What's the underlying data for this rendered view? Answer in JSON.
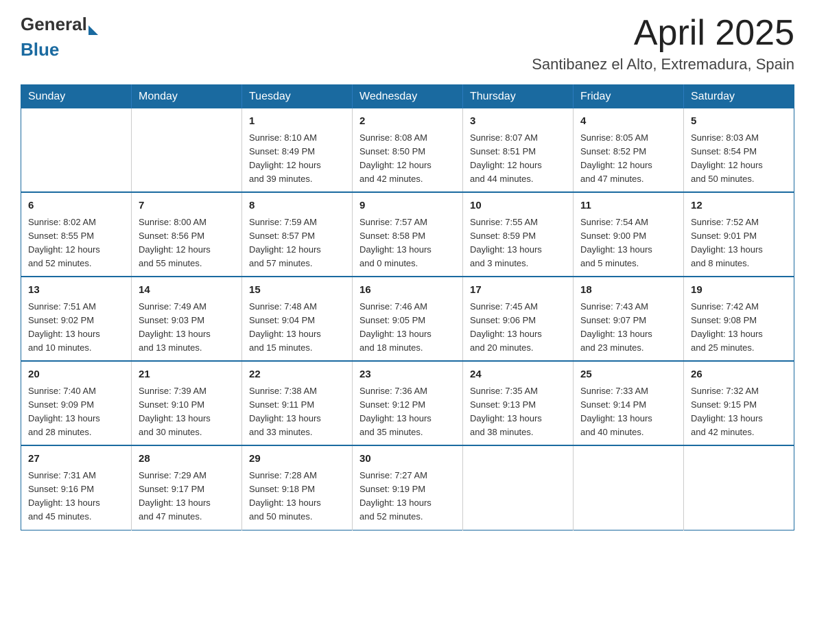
{
  "header": {
    "logo_general": "General",
    "logo_blue": "Blue",
    "title": "April 2025",
    "subtitle": "Santibanez el Alto, Extremadura, Spain"
  },
  "calendar": {
    "days_of_week": [
      "Sunday",
      "Monday",
      "Tuesday",
      "Wednesday",
      "Thursday",
      "Friday",
      "Saturday"
    ],
    "weeks": [
      [
        {
          "day": "",
          "info": ""
        },
        {
          "day": "",
          "info": ""
        },
        {
          "day": "1",
          "info": "Sunrise: 8:10 AM\nSunset: 8:49 PM\nDaylight: 12 hours\nand 39 minutes."
        },
        {
          "day": "2",
          "info": "Sunrise: 8:08 AM\nSunset: 8:50 PM\nDaylight: 12 hours\nand 42 minutes."
        },
        {
          "day": "3",
          "info": "Sunrise: 8:07 AM\nSunset: 8:51 PM\nDaylight: 12 hours\nand 44 minutes."
        },
        {
          "day": "4",
          "info": "Sunrise: 8:05 AM\nSunset: 8:52 PM\nDaylight: 12 hours\nand 47 minutes."
        },
        {
          "day": "5",
          "info": "Sunrise: 8:03 AM\nSunset: 8:54 PM\nDaylight: 12 hours\nand 50 minutes."
        }
      ],
      [
        {
          "day": "6",
          "info": "Sunrise: 8:02 AM\nSunset: 8:55 PM\nDaylight: 12 hours\nand 52 minutes."
        },
        {
          "day": "7",
          "info": "Sunrise: 8:00 AM\nSunset: 8:56 PM\nDaylight: 12 hours\nand 55 minutes."
        },
        {
          "day": "8",
          "info": "Sunrise: 7:59 AM\nSunset: 8:57 PM\nDaylight: 12 hours\nand 57 minutes."
        },
        {
          "day": "9",
          "info": "Sunrise: 7:57 AM\nSunset: 8:58 PM\nDaylight: 13 hours\nand 0 minutes."
        },
        {
          "day": "10",
          "info": "Sunrise: 7:55 AM\nSunset: 8:59 PM\nDaylight: 13 hours\nand 3 minutes."
        },
        {
          "day": "11",
          "info": "Sunrise: 7:54 AM\nSunset: 9:00 PM\nDaylight: 13 hours\nand 5 minutes."
        },
        {
          "day": "12",
          "info": "Sunrise: 7:52 AM\nSunset: 9:01 PM\nDaylight: 13 hours\nand 8 minutes."
        }
      ],
      [
        {
          "day": "13",
          "info": "Sunrise: 7:51 AM\nSunset: 9:02 PM\nDaylight: 13 hours\nand 10 minutes."
        },
        {
          "day": "14",
          "info": "Sunrise: 7:49 AM\nSunset: 9:03 PM\nDaylight: 13 hours\nand 13 minutes."
        },
        {
          "day": "15",
          "info": "Sunrise: 7:48 AM\nSunset: 9:04 PM\nDaylight: 13 hours\nand 15 minutes."
        },
        {
          "day": "16",
          "info": "Sunrise: 7:46 AM\nSunset: 9:05 PM\nDaylight: 13 hours\nand 18 minutes."
        },
        {
          "day": "17",
          "info": "Sunrise: 7:45 AM\nSunset: 9:06 PM\nDaylight: 13 hours\nand 20 minutes."
        },
        {
          "day": "18",
          "info": "Sunrise: 7:43 AM\nSunset: 9:07 PM\nDaylight: 13 hours\nand 23 minutes."
        },
        {
          "day": "19",
          "info": "Sunrise: 7:42 AM\nSunset: 9:08 PM\nDaylight: 13 hours\nand 25 minutes."
        }
      ],
      [
        {
          "day": "20",
          "info": "Sunrise: 7:40 AM\nSunset: 9:09 PM\nDaylight: 13 hours\nand 28 minutes."
        },
        {
          "day": "21",
          "info": "Sunrise: 7:39 AM\nSunset: 9:10 PM\nDaylight: 13 hours\nand 30 minutes."
        },
        {
          "day": "22",
          "info": "Sunrise: 7:38 AM\nSunset: 9:11 PM\nDaylight: 13 hours\nand 33 minutes."
        },
        {
          "day": "23",
          "info": "Sunrise: 7:36 AM\nSunset: 9:12 PM\nDaylight: 13 hours\nand 35 minutes."
        },
        {
          "day": "24",
          "info": "Sunrise: 7:35 AM\nSunset: 9:13 PM\nDaylight: 13 hours\nand 38 minutes."
        },
        {
          "day": "25",
          "info": "Sunrise: 7:33 AM\nSunset: 9:14 PM\nDaylight: 13 hours\nand 40 minutes."
        },
        {
          "day": "26",
          "info": "Sunrise: 7:32 AM\nSunset: 9:15 PM\nDaylight: 13 hours\nand 42 minutes."
        }
      ],
      [
        {
          "day": "27",
          "info": "Sunrise: 7:31 AM\nSunset: 9:16 PM\nDaylight: 13 hours\nand 45 minutes."
        },
        {
          "day": "28",
          "info": "Sunrise: 7:29 AM\nSunset: 9:17 PM\nDaylight: 13 hours\nand 47 minutes."
        },
        {
          "day": "29",
          "info": "Sunrise: 7:28 AM\nSunset: 9:18 PM\nDaylight: 13 hours\nand 50 minutes."
        },
        {
          "day": "30",
          "info": "Sunrise: 7:27 AM\nSunset: 9:19 PM\nDaylight: 13 hours\nand 52 minutes."
        },
        {
          "day": "",
          "info": ""
        },
        {
          "day": "",
          "info": ""
        },
        {
          "day": "",
          "info": ""
        }
      ]
    ]
  }
}
